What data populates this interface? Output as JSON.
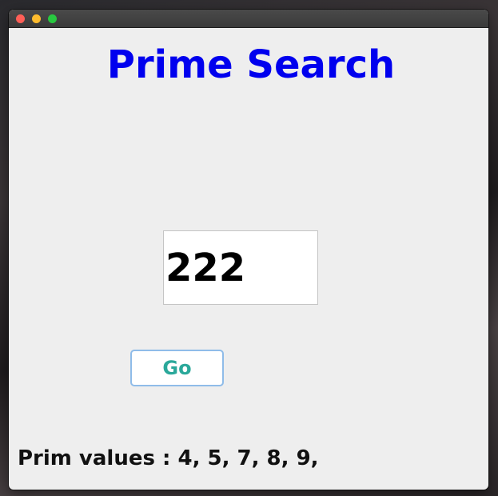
{
  "window": {
    "title": ""
  },
  "main": {
    "heading": "Prime Search",
    "number_input": {
      "value": "222"
    },
    "go_label": "Go",
    "result": {
      "label": "Prim values :",
      "values": "4, 5, 7, 8, 9,"
    }
  },
  "colors": {
    "heading": "#0000ee",
    "button_text": "#2aa89a",
    "button_border": "#8fbce9",
    "window_bg": "#eeeeee"
  }
}
